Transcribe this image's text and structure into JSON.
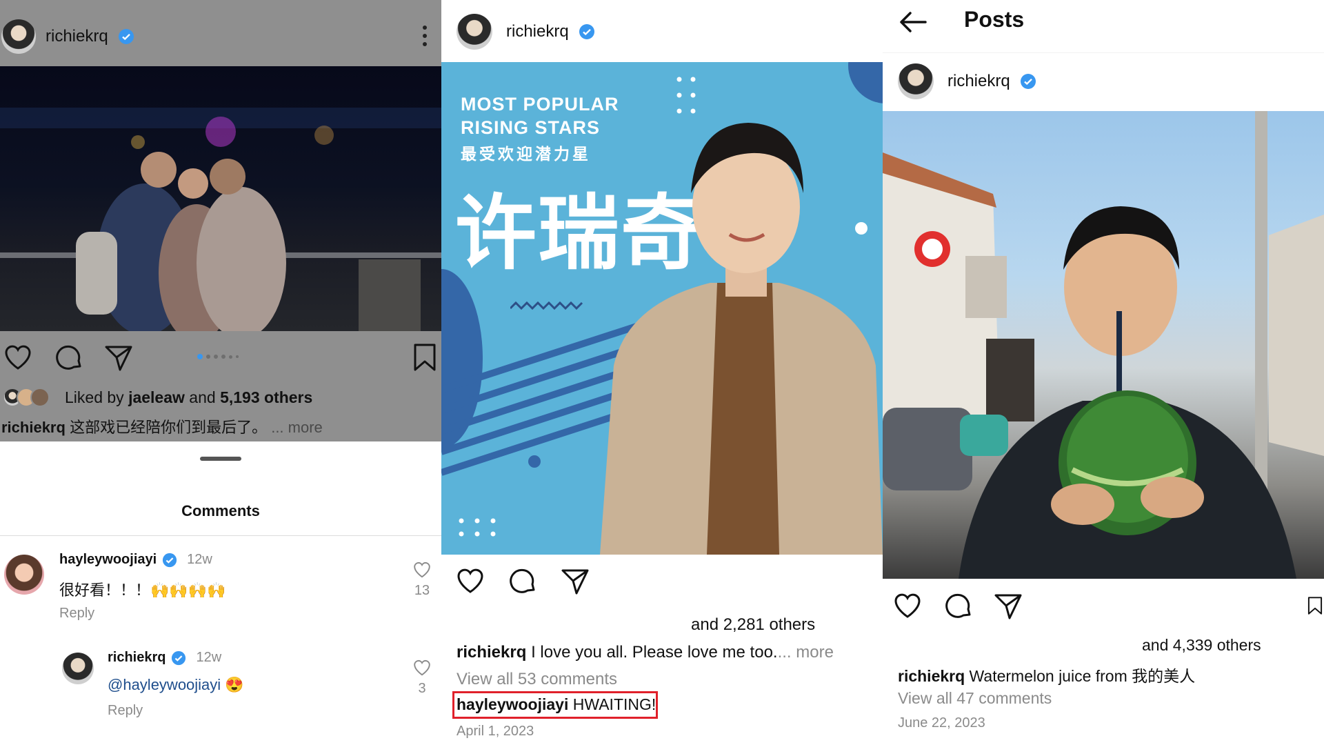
{
  "panel1": {
    "username": "richiekrq",
    "liked_prefix": "Liked by",
    "liked_user": "jaeleaw",
    "liked_and": "and",
    "liked_count": "5,193 others",
    "caption_user": "richiekrq",
    "caption_text": "这部戏已经陪你们到最后了。",
    "caption_more": "... more",
    "comments_title": "Comments",
    "comments": [
      {
        "user": "hayleywoojiayi",
        "time": "12w",
        "text": "很好看！！！",
        "emoji": "🙌🙌🙌🙌",
        "reply": "Reply",
        "likes": "13"
      },
      {
        "user": "richiekrq",
        "time": "12w",
        "text": "@hayleywoojiayi",
        "emoji": "😍",
        "reply": "Reply",
        "likes": "3"
      }
    ]
  },
  "panel2": {
    "username": "richiekrq",
    "poster_line1": "MOST POPULAR",
    "poster_line2": "RISING STARS",
    "poster_line3": "最受欢迎潜力星",
    "poster_name": "许瑞奇",
    "likes_text": "and 2,281 others",
    "caption_user": "richiekrq",
    "caption_text": "I love you all. Please love me too.",
    "caption_more": "... more",
    "view_comments": "View all 53 comments",
    "highlight_user": "hayleywoojiayi",
    "highlight_text": "HWAITING!",
    "date": "April 1, 2023"
  },
  "panel3": {
    "title": "Posts",
    "username": "richiekrq",
    "likes_text": "and 4,339 others",
    "caption_user": "richiekrq",
    "caption_text": "Watermelon juice from 我的美人",
    "view_comments": "View all 47 comments",
    "date": "June 22, 2023"
  },
  "colors": {
    "verified": "#3897f0",
    "highlight_box": "#e0202a",
    "poster_bg": "#5bb3d9"
  }
}
